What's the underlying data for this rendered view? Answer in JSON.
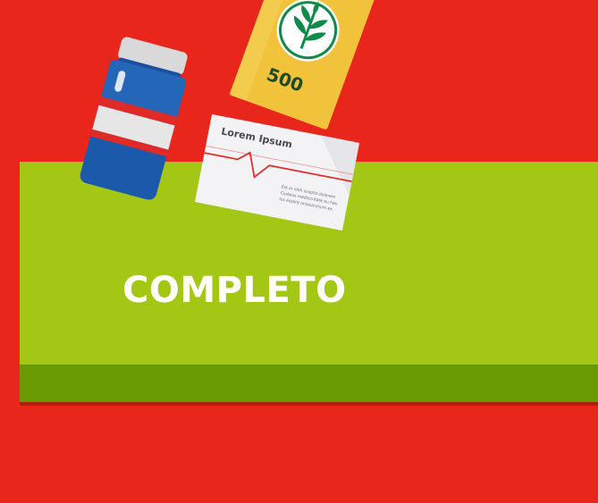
{
  "title": "COMPLETO",
  "box": {
    "label": "500"
  },
  "card": {
    "heading": "Lorem Ipsum",
    "fine_print": [
      "Est in nibh sceptio dolorem",
      "Custeus mediocritate eu has.",
      "Ius essent mnesarchum ex."
    ]
  },
  "colors": {
    "background": "#e8261b",
    "panel": "#a4c716",
    "panel_base": "#6a9a02",
    "bottle_blue": "#2563b6",
    "bottle_stripe": "#e02a27",
    "box_yellow": "#f0c43a",
    "leaf_green": "#0f8a4a"
  },
  "icons": {
    "bottle": "medicine-bottle-icon",
    "box": "herbal-supplement-box-icon",
    "leaf": "leaf-icon",
    "card": "prescription-card-icon"
  }
}
